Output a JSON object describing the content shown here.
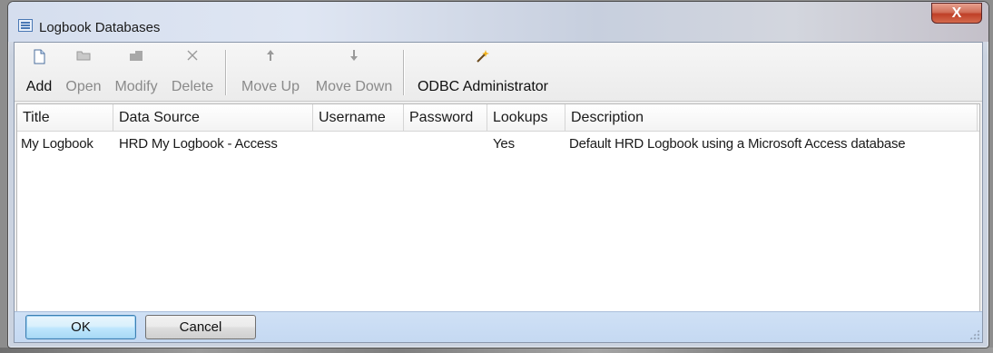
{
  "window": {
    "title": "Logbook Databases",
    "close_glyph": "X"
  },
  "toolbar": {
    "add": {
      "label": "Add",
      "icon": "new-file-icon"
    },
    "open": {
      "label": "Open",
      "icon": "open-folder-icon"
    },
    "modify": {
      "label": "Modify",
      "icon": "modify-icon"
    },
    "delete": {
      "label": "Delete",
      "icon": "delete-x-icon"
    },
    "move_up": {
      "label": "Move Up",
      "icon": "arrow-up-icon"
    },
    "move_down": {
      "label": "Move Down",
      "icon": "arrow-down-icon"
    },
    "odbc": {
      "label": "ODBC Administrator",
      "icon": "magic-wand-icon"
    }
  },
  "list": {
    "columns": [
      "Title",
      "Data Source",
      "Username",
      "Password",
      "Lookups",
      "Description"
    ],
    "rows": [
      {
        "title": "My Logbook",
        "data_source": "HRD My Logbook - Access",
        "username": "",
        "password": "",
        "lookups": "Yes",
        "description": "Default HRD Logbook using a Microsoft Access database"
      }
    ]
  },
  "footer": {
    "ok_label": "OK",
    "cancel_label": "Cancel"
  },
  "colors": {
    "accent": "#3c7fb1",
    "footer_bg": "#c5d9f2",
    "close_button": "#c7432a"
  }
}
